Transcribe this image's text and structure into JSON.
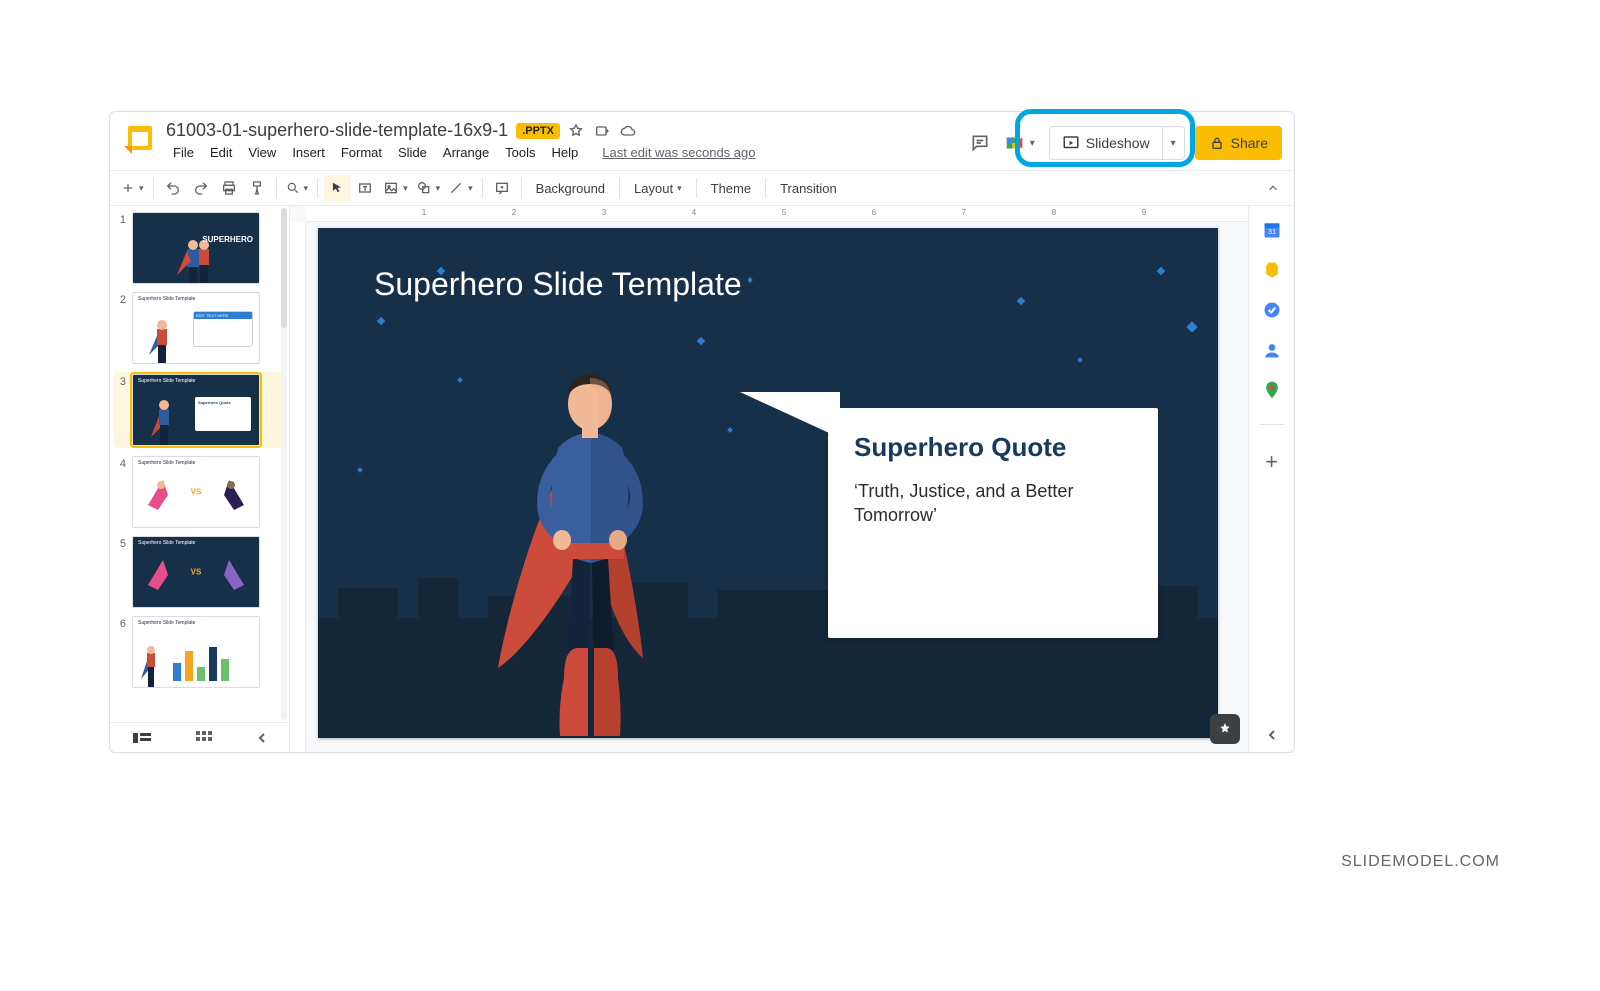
{
  "doc": {
    "title": "61003-01-superhero-slide-template-16x9-1",
    "badge": ".PPTX",
    "last_edit": "Last edit was seconds ago"
  },
  "menu": {
    "file": "File",
    "edit": "Edit",
    "view": "View",
    "insert": "Insert",
    "format": "Format",
    "slide": "Slide",
    "arrange": "Arrange",
    "tools": "Tools",
    "help": "Help"
  },
  "buttons": {
    "slideshow": "Slideshow",
    "share": "Share"
  },
  "toolbar": {
    "background": "Background",
    "layout": "Layout",
    "theme": "Theme",
    "transition": "Transition"
  },
  "ruler": {
    "t1": "1",
    "t2": "2",
    "t3": "3",
    "t4": "4",
    "t5": "5",
    "t6": "6",
    "t7": "7",
    "t8": "8",
    "t9": "9"
  },
  "slide": {
    "title": "Superhero Slide Template",
    "quote_heading": "Superhero Quote",
    "quote_body": "‘Truth, Justice, and a Better Tomorrow’"
  },
  "thumbs": {
    "n1": "1",
    "n2": "2",
    "n3": "3",
    "n4": "4",
    "n5": "5",
    "n6": "6",
    "label": "Superhero Slide Template",
    "t1_title": "SUPERHERO",
    "t2_box_hd": "EDIT TEXT HERE",
    "t3_quote": "Superhero Quote",
    "vs": "VS"
  },
  "watermark": "SLIDEMODEL.COM"
}
